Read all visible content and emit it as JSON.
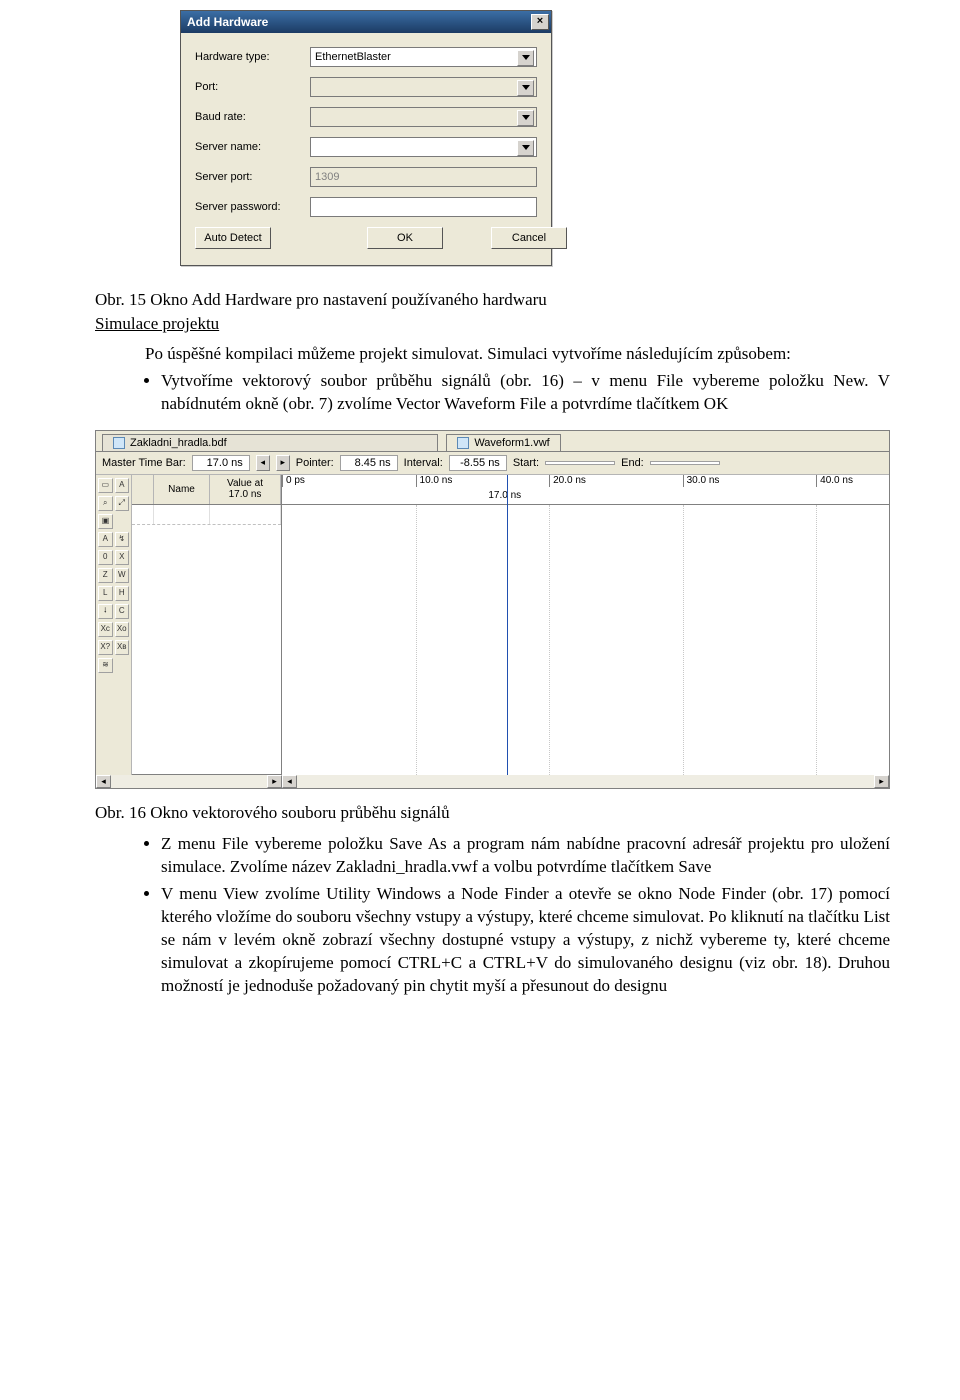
{
  "dialog": {
    "title": "Add Hardware",
    "labels": {
      "hw_type": "Hardware type:",
      "port": "Port:",
      "baud": "Baud rate:",
      "server_name": "Server name:",
      "server_port": "Server port:",
      "server_pw": "Server password:"
    },
    "values": {
      "hw_type": "EthernetBlaster",
      "port": "",
      "baud": "",
      "server_name": "",
      "server_port": "1309",
      "server_pw": ""
    },
    "buttons": {
      "auto_detect": "Auto Detect",
      "ok": "OK",
      "cancel": "Cancel"
    }
  },
  "doc": {
    "caption1": "Obr. 15 Okno Add Hardware pro nastavení používaného hardwaru",
    "sim_heading": "Simulace projektu",
    "para1": "Po úspěšné kompilaci můžeme projekt simulovat. Simulaci vytvoříme následujícím způsobem:",
    "bullet1": "Vytvoříme vektorový soubor průběhu signálů (obr. 16) – v menu File vybereme položku New. V nabídnutém okně (obr. 7) zvolíme Vector Waveform File a potvrdíme tlačítkem OK",
    "caption2": "Obr. 16 Okno vektorového souboru průběhu signálů",
    "bullet2": "Z menu File vybereme položku Save As a program nám nabídne pracovní adresář projektu pro uložení simulace. Zvolíme název Zakladni_hradla.vwf a volbu potvrdíme tlačítkem Save",
    "bullet3": "V menu View zvolíme Utility Windows a Node Finder a otevře se okno Node Finder (obr. 17) pomocí kterého vložíme do souboru všechny vstupy a výstupy, které chceme simulovat. Po kliknutí na tlačítku List se nám v levém okně zobrazí všechny dostupné vstupy a výstupy, z nichž vybereme ty, které chceme simulovat a zkopírujeme pomocí CTRL+C a CTRL+V do simulovaného designu (viz obr. 18). Druhou možností je jednoduše požadovaný pin chytit myší a přesunout do designu"
  },
  "wf": {
    "tab_inactive": "Zakladni_hradla.bdf",
    "tab_active": "Waveform1.vwf",
    "toolbar": {
      "master_lbl": "Master Time Bar:",
      "master_val": "17.0 ns",
      "pointer_lbl": "Pointer:",
      "pointer_val": "8.45 ns",
      "interval_lbl": "Interval:",
      "interval_val": "-8.55 ns",
      "start_lbl": "Start:",
      "start_val": "",
      "end_lbl": "End:",
      "end_val": ""
    },
    "left_hdr": {
      "name": "Name",
      "value": "Value at\n17.0 ns"
    },
    "ruler": {
      "ticks": [
        "0 ps",
        "10.0 ns",
        "20.0 ns",
        "30.0 ns",
        "40.0 ns"
      ],
      "cursor": "17.0 ns",
      "cursor_pct": 34
    }
  }
}
